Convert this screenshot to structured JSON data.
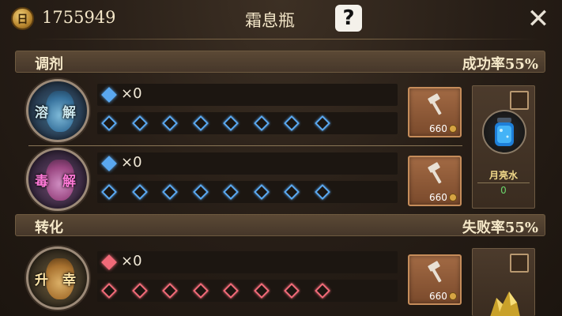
{
  "header": {
    "coin_icon_char": "日",
    "coin_amount": "1755949",
    "title": "霜息瓶",
    "help_char": "?",
    "close_char": "✕"
  },
  "sections": [
    {
      "label": "调剂",
      "rate": "成功率55%",
      "rows": [
        {
          "rune": "溶 解",
          "gem_color": "blue",
          "gem_count": "×0",
          "cost": "660"
        },
        {
          "rune": "毒 解",
          "gem_color": "blue",
          "gem_count": "×0",
          "cost": "660"
        }
      ],
      "material": {
        "name": "月亮水",
        "count": "0"
      }
    },
    {
      "label": "转化",
      "rate": "失败率55%",
      "rows": [
        {
          "rune": "升 幸",
          "gem_color": "red",
          "gem_count": "×0",
          "cost": "660"
        }
      ]
    }
  ],
  "colors": {
    "blue_gem": "#5aa8f0",
    "red_gem": "#f06a78"
  },
  "icons": {
    "coin": "gold-coin-icon",
    "help": "question-mark-icon",
    "close": "close-icon",
    "hammer": "hammer-icon",
    "potion": "potion-icon",
    "material": "blue-jar-icon"
  }
}
